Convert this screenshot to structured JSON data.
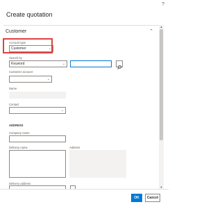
{
  "dialog": {
    "title": "Create quotation",
    "help_icon": "question-mark-icon"
  },
  "section": {
    "header": "Customer",
    "collapse_icon": "chevron-up-icon"
  },
  "form": {
    "account_type": {
      "label": "Account type",
      "value": "Customer"
    },
    "search_by": {
      "label": "Search by",
      "value": "Keyword"
    },
    "search": {
      "value": "",
      "icon": "search-icon"
    },
    "customer_account": {
      "label": "Customer account",
      "value": ""
    },
    "name": {
      "label": "Name",
      "value": ""
    },
    "contact": {
      "label": "Contact",
      "value": ""
    },
    "address_heading": "ADDRESS",
    "company_name": {
      "label": "Company name",
      "value": ""
    },
    "delivery_name": {
      "label": "Delivery name",
      "value": ""
    },
    "address": {
      "label": "Address",
      "value": ""
    },
    "delivery_address": {
      "label": "Delivery address",
      "value": ""
    }
  },
  "buttons": {
    "ok": "OK",
    "cancel": "Cancel"
  },
  "colors": {
    "primary": "#0078d4",
    "highlight": "#e0403f"
  }
}
